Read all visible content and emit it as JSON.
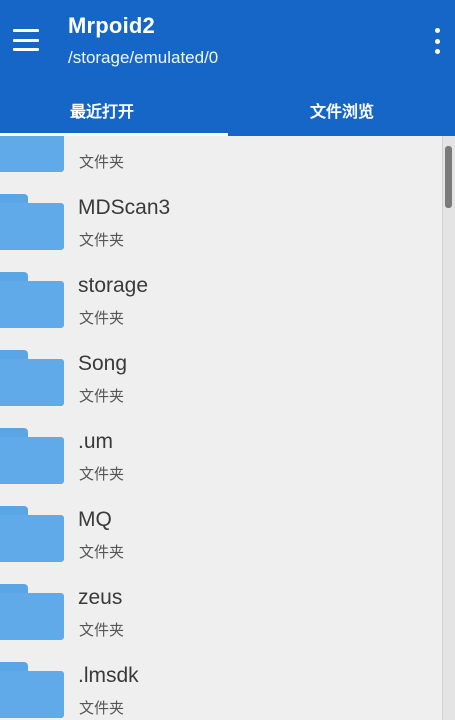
{
  "appbar": {
    "title": "Mrpoid2",
    "path": "/storage/emulated/0",
    "menu_icon": "hamburger-menu-icon",
    "overflow_icon": "more-vertical-icon",
    "background_color": "#1566c6"
  },
  "tabs": [
    {
      "label": "最近打开",
      "selected": true
    },
    {
      "label": "文件浏览",
      "selected": false
    }
  ],
  "files": [
    {
      "name": "",
      "kind": "文件夹"
    },
    {
      "name": "MDScan3",
      "kind": "文件夹"
    },
    {
      "name": "storage",
      "kind": "文件夹"
    },
    {
      "name": "Song",
      "kind": "文件夹"
    },
    {
      "name": ".um",
      "kind": "文件夹"
    },
    {
      "name": "MQ",
      "kind": "文件夹"
    },
    {
      "name": "zeus",
      "kind": "文件夹"
    },
    {
      "name": ".lmsdk",
      "kind": "文件夹"
    }
  ],
  "folder_icon": "folder-icon",
  "folder_color": "#60aaea"
}
